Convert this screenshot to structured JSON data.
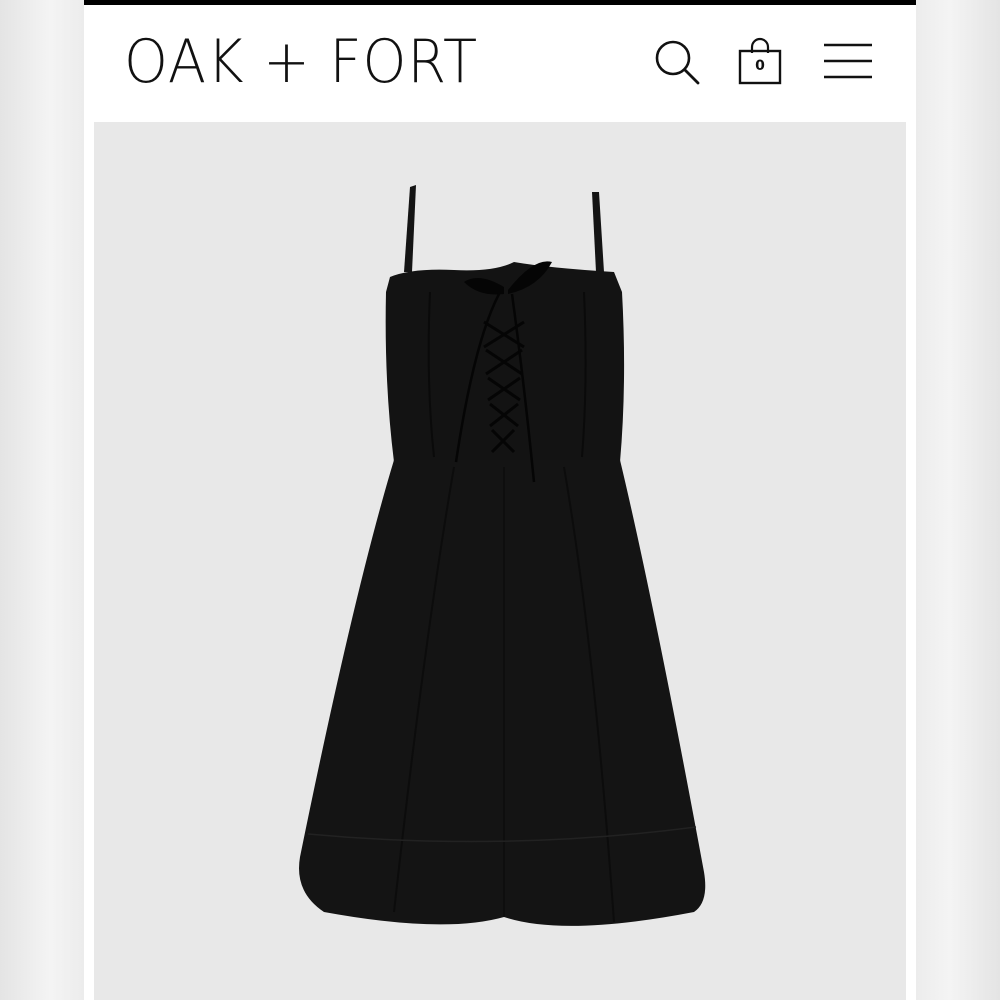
{
  "header": {
    "logo_text": "OAK + FORT",
    "search_icon": "search-icon",
    "bag_icon": "shopping-bag-icon",
    "bag_count": "0",
    "menu_icon": "hamburger-menu-icon"
  },
  "colors": {
    "page_background": "#ffffff",
    "image_background": "#e8e8e8",
    "product_color": "#121212"
  }
}
